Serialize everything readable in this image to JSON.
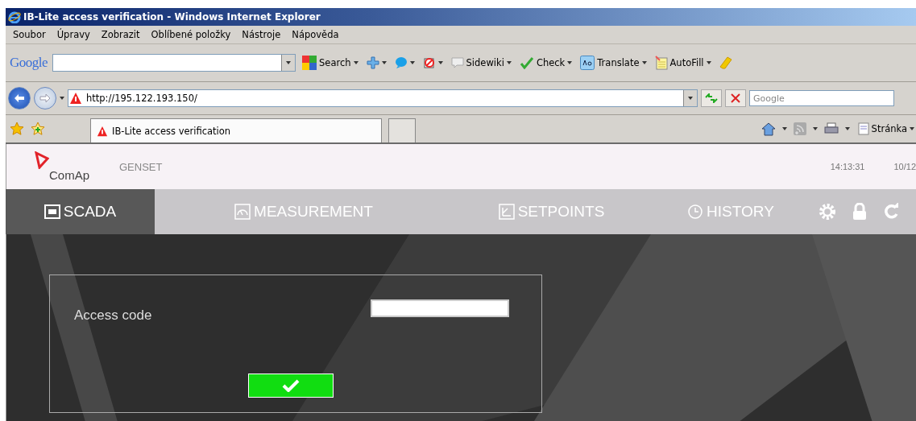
{
  "window": {
    "title": "IB-Lite access verification - Windows Internet Explorer"
  },
  "menu": [
    "Soubor",
    "Úpravy",
    "Zobrazit",
    "Oblíbené položky",
    "Nástroje",
    "Nápověda"
  ],
  "google_toolbar": {
    "logo": "Google",
    "buttons": [
      {
        "kind": "search",
        "label": "Search"
      },
      {
        "kind": "plus"
      },
      {
        "kind": "quote"
      },
      {
        "kind": "popup"
      },
      {
        "kind": "sidewiki",
        "label": "Sidewiki"
      },
      {
        "kind": "check",
        "label": "Check"
      },
      {
        "kind": "translate",
        "label": "Translate"
      },
      {
        "kind": "autofill",
        "label": "AutoFill"
      },
      {
        "kind": "marker"
      }
    ]
  },
  "address_bar": {
    "url": "http://195.122.193.150/",
    "search_placeholder": "Google"
  },
  "tab": {
    "title": "IB-Lite access verification"
  },
  "command_bar": {
    "page_label": "Stránka"
  },
  "app": {
    "logo": "ComAp",
    "device": "GENSET",
    "time": "14:13:31",
    "date": "10/12",
    "nav": [
      {
        "kind": "scada",
        "label": "SCADA",
        "selected": true
      },
      {
        "kind": "measurement",
        "label": "MEASUREMENT",
        "selected": false
      },
      {
        "kind": "setpoints",
        "label": "SETPOINTS",
        "selected": false
      },
      {
        "kind": "history",
        "label": "HISTORY",
        "selected": false
      }
    ],
    "form": {
      "label": "Access code"
    }
  }
}
